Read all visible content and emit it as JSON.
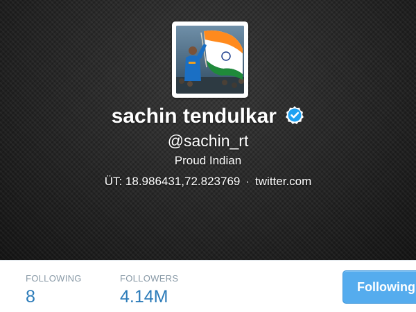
{
  "profile": {
    "name": "sachin tendulkar",
    "handle": "@sachin_rt",
    "bio": "Proud Indian",
    "location": "ÜT: 18.986431,72.823769",
    "separator": "·",
    "website": "twitter.com",
    "verified": true
  },
  "stats": {
    "following_label": "FOLLOWING",
    "following_value": "8",
    "followers_label": "FOLLOWERS",
    "followers_value": "4.14M"
  },
  "actions": {
    "follow_button_label": "Following"
  },
  "colors": {
    "accent": "#55acee",
    "stat_value": "#2b7bb9",
    "stat_label": "#8899a6",
    "header_bg": "#232323",
    "verified_badge": "#1da1f2"
  },
  "icons": {
    "verified": "verified-badge-icon"
  }
}
